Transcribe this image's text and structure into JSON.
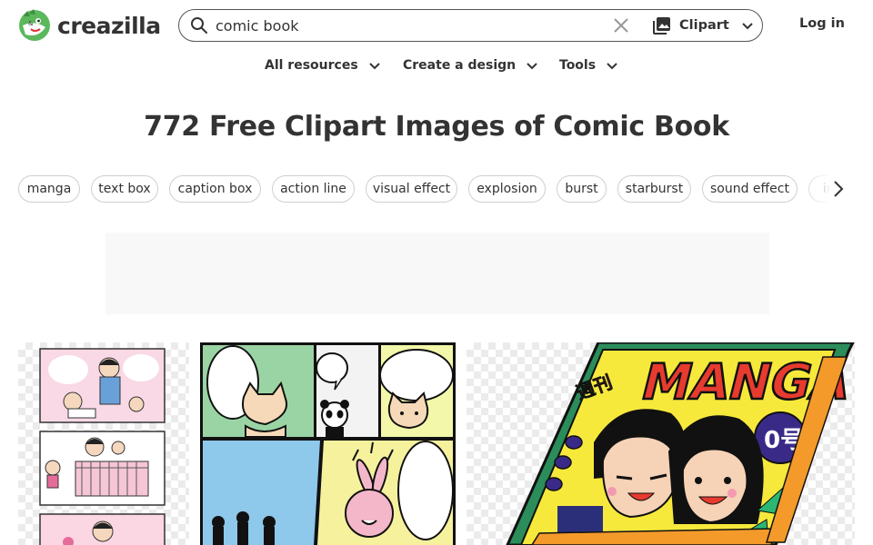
{
  "header": {
    "logo_text": "creazilla",
    "search": {
      "value": "comic book",
      "placeholder": ""
    },
    "type_select": {
      "label": "Clipart",
      "icon": "image-gallery-icon"
    },
    "login_label": "Log in"
  },
  "nav": [
    {
      "label": "All resources"
    },
    {
      "label": "Create a design"
    },
    {
      "label": "Tools"
    }
  ],
  "page_title": "772 Free Clipart Images of Comic Book",
  "tags": [
    "manga",
    "text box",
    "caption box",
    "action line",
    "visual effect",
    "explosion",
    "burst",
    "starburst",
    "sound effect",
    "impact"
  ],
  "gallery": [
    {
      "name": "family manga panels clipart"
    },
    {
      "name": "cat and panda comic page clipart"
    },
    {
      "name": "weekly manga magazine clipart",
      "cover_title": "MANGA",
      "cover_kanji": "週刊",
      "cover_issue": "0号"
    }
  ],
  "colors": {
    "brand_green": "#4caf50",
    "text": "#333333",
    "border": "#cfcfcf"
  }
}
